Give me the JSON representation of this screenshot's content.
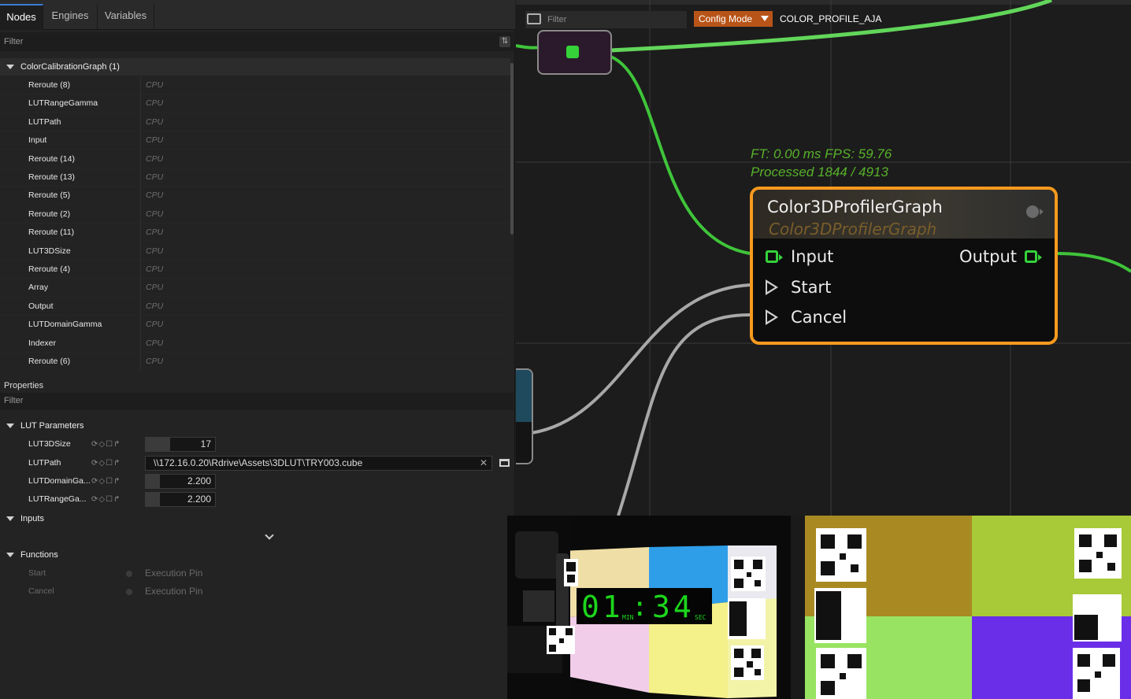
{
  "tabs": [
    {
      "label": "Nodes"
    },
    {
      "label": "Engines"
    },
    {
      "label": "Variables"
    }
  ],
  "nodes_filter": {
    "placeholder": "Filter"
  },
  "tree": {
    "root_label": "ColorCalibrationGraph (1)",
    "items": [
      {
        "name": "Reroute (8)",
        "type": "CPU"
      },
      {
        "name": "LUTRangeGamma",
        "type": "CPU"
      },
      {
        "name": "LUTPath",
        "type": "CPU"
      },
      {
        "name": "Input",
        "type": "CPU"
      },
      {
        "name": "Reroute (14)",
        "type": "CPU"
      },
      {
        "name": "Reroute (13)",
        "type": "CPU"
      },
      {
        "name": "Reroute (5)",
        "type": "CPU"
      },
      {
        "name": "Reroute (2)",
        "type": "CPU"
      },
      {
        "name": "Reroute (11)",
        "type": "CPU"
      },
      {
        "name": "LUT3DSize",
        "type": "CPU"
      },
      {
        "name": "Reroute (4)",
        "type": "CPU"
      },
      {
        "name": "Array",
        "type": "CPU"
      },
      {
        "name": "Output",
        "type": "CPU"
      },
      {
        "name": "LUTDomainGamma",
        "type": "CPU"
      },
      {
        "name": "Indexer",
        "type": "CPU"
      },
      {
        "name": "Reroute (6)",
        "type": "CPU"
      }
    ]
  },
  "properties": {
    "title": "Properties",
    "filter_placeholder": "Filter",
    "lut_section": "LUT Parameters",
    "lut3dsize": {
      "name": "LUT3DSize",
      "value": "17",
      "fill": 0.35
    },
    "lutpath": {
      "name": "LUTPath",
      "value": "\\\\172.16.0.20\\Rdrive\\Assets\\3DLUT\\TRY003.cube",
      "clear": "✕"
    },
    "lutdomain": {
      "name": "LUTDomainGa...",
      "value": "2.200",
      "fill": 0.2
    },
    "lutrange": {
      "name": "LUTRangeGa...",
      "value": "2.200",
      "fill": 0.2
    },
    "inputs_section": "Inputs",
    "functions_section": "Functions",
    "functions": [
      {
        "name": "Start",
        "type": "Execution Pin"
      },
      {
        "name": "Cancel",
        "type": "Execution Pin"
      }
    ],
    "row_icons": "⟳◇☐↱"
  },
  "graph": {
    "filter_placeholder": "Filter",
    "config_mode": "Config Mode",
    "profile": "COLOR_PROFILE_AJA",
    "stats_line1": "FT: 0.00 ms FPS: 59.76",
    "stats_line2": "Processed 1844 / 4913",
    "node": {
      "title": "Color3DProfilerGraph",
      "subtitle": "Color3DProfilerGraph",
      "input": "Input",
      "output": "Output",
      "start": "Start",
      "cancel": "Cancel"
    }
  },
  "feed1": {
    "timer": {
      "minutes": "01",
      "sep": ":",
      "seconds": "34",
      "min_unit": "MIN",
      "sec_unit": "SEC"
    }
  },
  "colors": {
    "accent_orange": "#f79a1e",
    "wire_green": "#3fc43a",
    "wire_gray": "#a8a8a8",
    "stats_green": "#58b22a",
    "config_mode_bg": "#b85418"
  }
}
